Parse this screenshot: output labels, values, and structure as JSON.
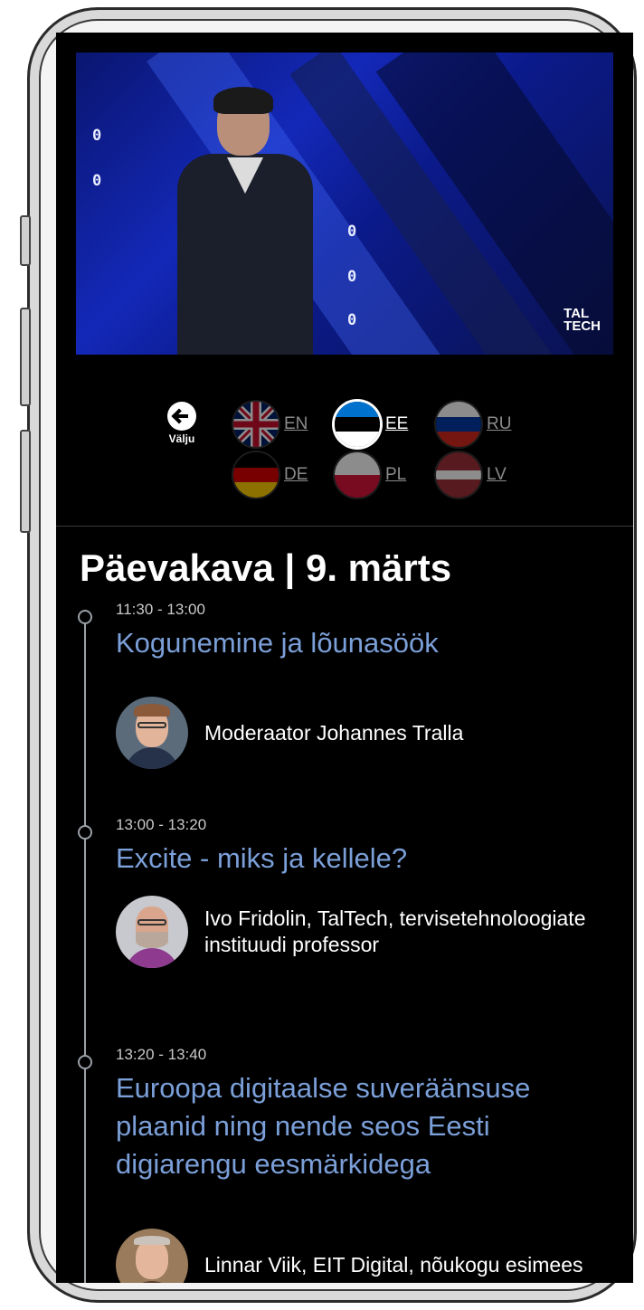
{
  "video": {
    "logo_line1": "TAL",
    "logo_line2": "TECH"
  },
  "controls": {
    "exit_label": "Välju",
    "languages": [
      {
        "code": "EN",
        "active": false
      },
      {
        "code": "EE",
        "active": true
      },
      {
        "code": "RU",
        "active": false
      },
      {
        "code": "DE",
        "active": false
      },
      {
        "code": "PL",
        "active": false
      },
      {
        "code": "LV",
        "active": false
      }
    ]
  },
  "agenda": {
    "title": "Päevakava | 9. märts",
    "items": [
      {
        "time": "11:30 - 13:00",
        "session": "Kogunemine ja lõunasöök",
        "speaker": "Moderaator Johannes Tralla"
      },
      {
        "time": "13:00 - 13:20",
        "session": "Excite - miks ja kellele?",
        "speaker": "Ivo Fridolin, TalTech, tervisetehnoloogiate instituudi professor"
      },
      {
        "time": "13:20 - 13:40",
        "session": "Euroopa digitaalse suveräänsuse plaanid ning nende seos Eesti digiarengu eesmärkidega",
        "speaker": "Linnar Viik, EIT Digital, nõukogu esimees"
      }
    ]
  },
  "colors": {
    "background": "#000000",
    "session_link": "#7b9fd8",
    "timeline": "#9aa0a6"
  }
}
